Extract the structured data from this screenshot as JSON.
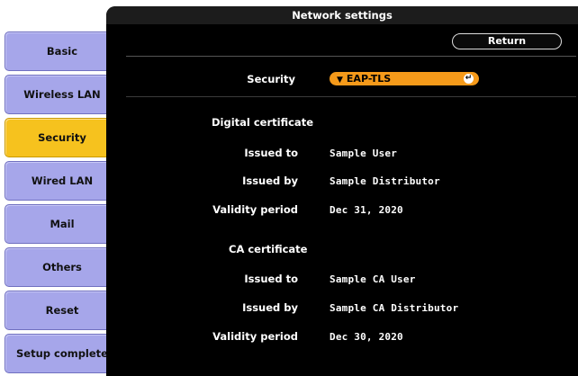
{
  "window": {
    "title": "Network settings"
  },
  "toolbar": {
    "return_label": "Return"
  },
  "sidebar": {
    "items": [
      {
        "label": "Basic",
        "active": false
      },
      {
        "label": "Wireless LAN",
        "active": false
      },
      {
        "label": "Security",
        "active": true
      },
      {
        "label": "Wired LAN",
        "active": false
      },
      {
        "label": "Mail",
        "active": false
      },
      {
        "label": "Others",
        "active": false
      },
      {
        "label": "Reset",
        "active": false
      },
      {
        "label": "Setup complete",
        "active": false
      }
    ]
  },
  "security": {
    "label": "Security",
    "value": "EAP-TLS"
  },
  "digital_certificate": {
    "heading": "Digital certificate",
    "issued_to_label": "Issued to",
    "issued_to": "Sample User",
    "issued_by_label": "Issued by",
    "issued_by": "Sample Distributor",
    "validity_label": "Validity period",
    "validity": "Dec 31, 2020"
  },
  "ca_certificate": {
    "heading": "CA certificate",
    "issued_to_label": "Issued to",
    "issued_to": "Sample CA User",
    "issued_by_label": "Issued by",
    "issued_by": "Sample CA Distributor",
    "validity_label": "Validity period",
    "validity": "Dec 30, 2020"
  },
  "colors": {
    "tab": "#a6a6ea",
    "tab_active": "#f6c21e",
    "dropdown": "#f59a1a",
    "panel": "#000000"
  }
}
